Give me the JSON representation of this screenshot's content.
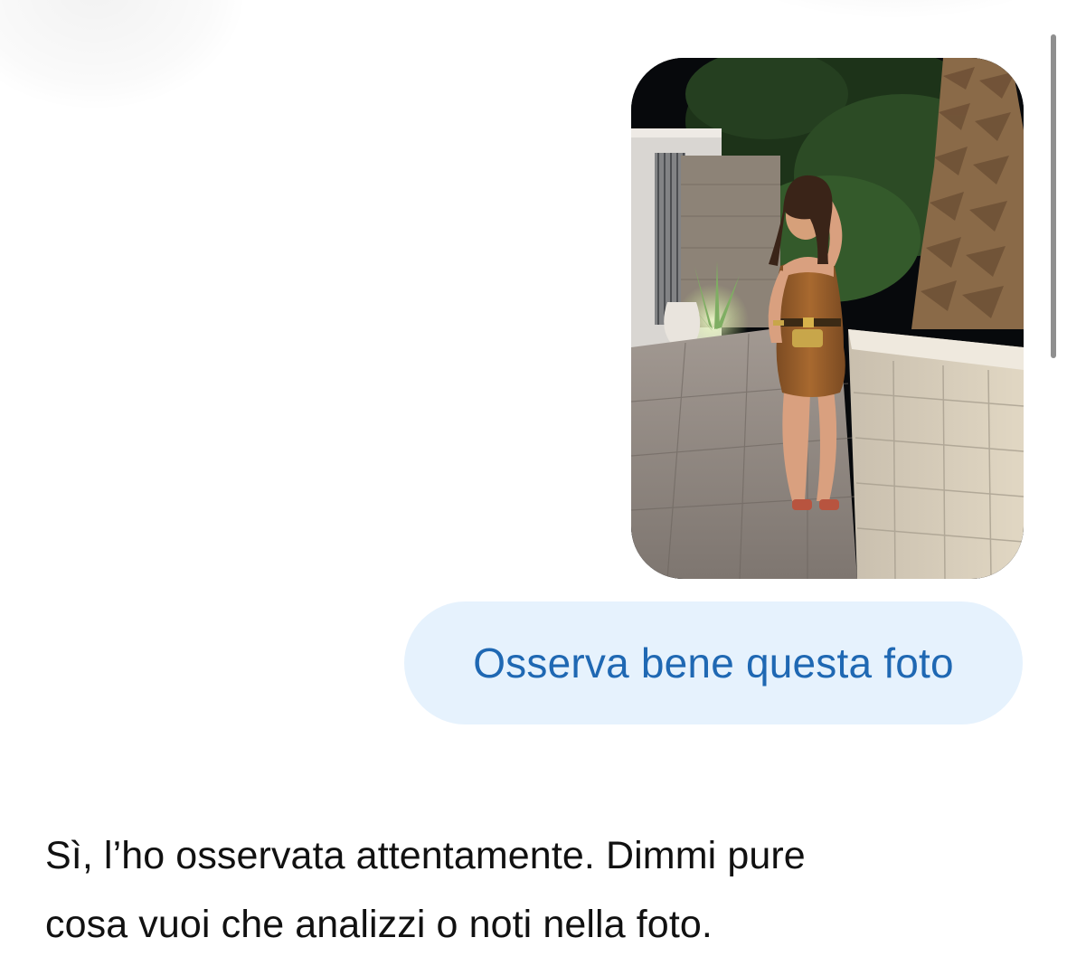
{
  "conversation": {
    "user_message": {
      "attachment_icon": "photo-image",
      "text": "Osserva bene questa foto"
    },
    "assistant_message": {
      "text": "Sì, l’ho osservata attentamente. Dimmi pure\ncosa vuoi che analizzi o noti nella foto."
    }
  },
  "colors": {
    "page_background": "#ffffff",
    "user_bubble_background": "#e6f2fd",
    "user_bubble_text": "#1f68b3",
    "assistant_text": "#111111",
    "scrollbar": "#8f8f8f"
  }
}
